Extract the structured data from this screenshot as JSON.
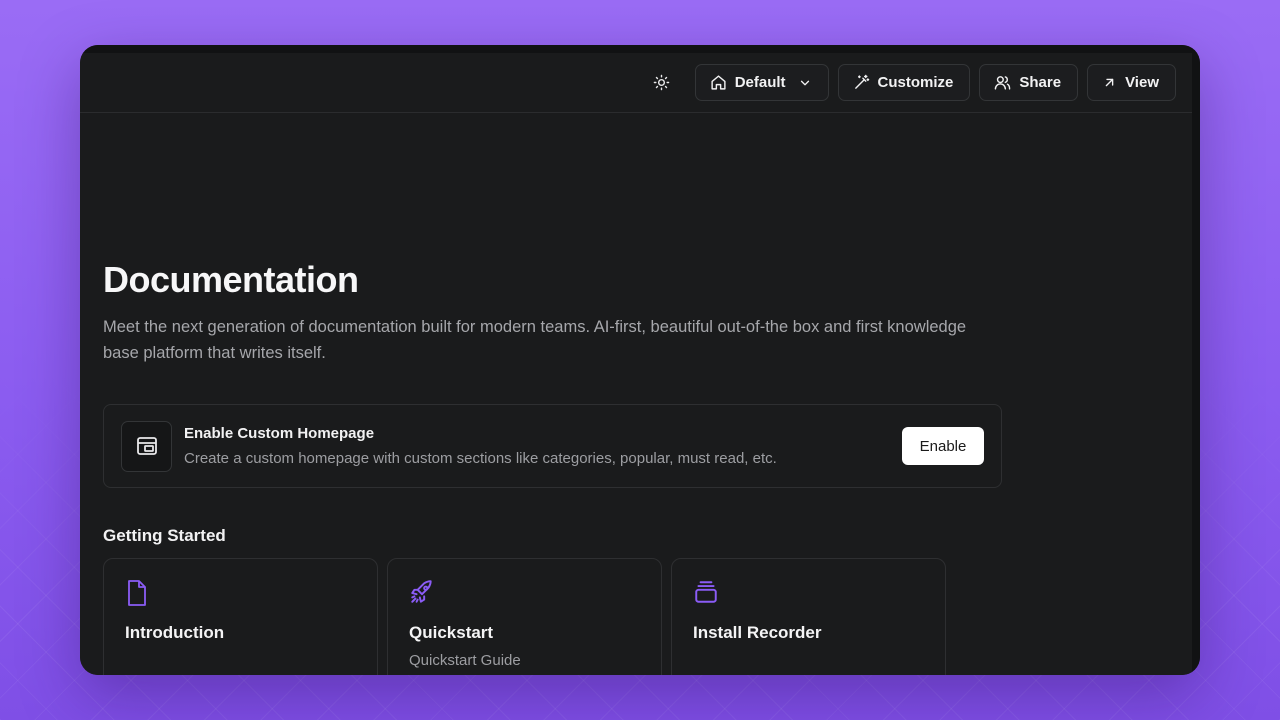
{
  "toolbar": {
    "theme_icon": "sun-icon",
    "default_label": "Default",
    "customize_label": "Customize",
    "share_label": "Share",
    "view_label": "View"
  },
  "page": {
    "title": "Documentation",
    "description": "Meet the next generation of documentation built for modern teams. AI-first, beautiful out-of-the box and first knowledge base platform that writes itself."
  },
  "banner": {
    "icon": "layout-icon",
    "title": "Enable Custom Homepage",
    "description": "Create a custom homepage with custom sections like categories, popular, must read, etc.",
    "button_label": "Enable"
  },
  "getting_started": {
    "title": "Getting Started",
    "cards": [
      {
        "icon": "document-icon",
        "title": "Introduction",
        "subtitle": ""
      },
      {
        "icon": "rocket-icon",
        "title": "Quickstart",
        "subtitle": "Quickstart Guide"
      },
      {
        "icon": "stack-icon",
        "title": "Install Recorder",
        "subtitle": ""
      }
    ]
  },
  "colors": {
    "accent": "#8b5cf6",
    "background": "#1a1b1c",
    "backdrop": "#8b5cf0"
  }
}
